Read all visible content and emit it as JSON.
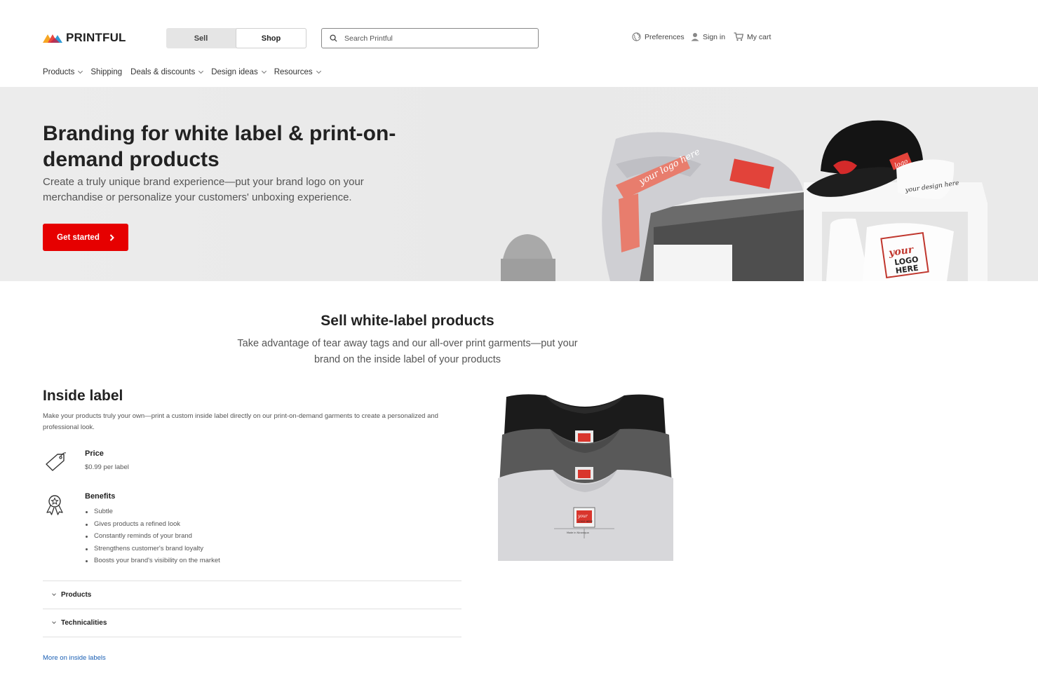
{
  "header": {
    "logo_text": "PRINTFUL",
    "toggle": {
      "sell_label": "Sell",
      "shop_label": "Shop",
      "active": "Shop"
    },
    "search": {
      "placeholder": "Search Printful",
      "value": ""
    },
    "preferences_label": "Preferences",
    "signin_label": "Sign in",
    "cart_label": "My cart"
  },
  "nav": {
    "items": [
      {
        "label": "Products",
        "dropdown": true
      },
      {
        "label": "Shipping",
        "dropdown": false
      },
      {
        "label": "Deals & discounts",
        "dropdown": true
      },
      {
        "label": "Design ideas",
        "dropdown": true
      },
      {
        "label": "Resources",
        "dropdown": true
      }
    ]
  },
  "hero": {
    "title": "Branding for white label & print-on-demand products",
    "subtitle": "Create a truly unique brand experience—put your brand logo on your merchandise or personalize your customers' unboxing experience.",
    "cta_label": "Get started",
    "art_texts": {
      "sweatshirt_print": "your logo here",
      "cap_tag": "logo",
      "tee_script": "your design here",
      "box_line1": "your",
      "box_line2": "LOGO",
      "box_line3": "HERE"
    }
  },
  "section": {
    "title": "Sell white-label products",
    "subtitle": "Take advantage of tear away tags and our all-over print garments—put your brand on the inside label of your products"
  },
  "inside_label": {
    "title": "Inside label",
    "description": "Make your products truly your own—print a custom inside label directly on our print-on-demand garments to create a personalized and professional look.",
    "price_title": "Price",
    "price_value": "$0.99 per label",
    "benefits_title": "Benefits",
    "benefits": [
      "Subtle",
      "Gives products a refined look",
      "Constantly reminds of your brand",
      "Strengthens customer's brand loyalty",
      "Boosts your brand's visibility on the market"
    ],
    "accordion": [
      {
        "label": "Products"
      },
      {
        "label": "Technicalities"
      }
    ],
    "more_link": "More on inside labels",
    "shirt_label_text": "your",
    "shirt_label_text2": "LOGO HERE",
    "shirt_tag_small": "Made in Nicaragua"
  },
  "colors": {
    "brand_red": "#e60000",
    "link_blue": "#1a5fb4",
    "hero_bg": "#ebebeb"
  },
  "icons": [
    "logo-mountains-icon",
    "search-icon",
    "globe-icon",
    "user-icon",
    "cart-icon",
    "chevron-right-icon",
    "price-tag-icon",
    "award-ribbon-icon",
    "chevron-down-icon"
  ]
}
